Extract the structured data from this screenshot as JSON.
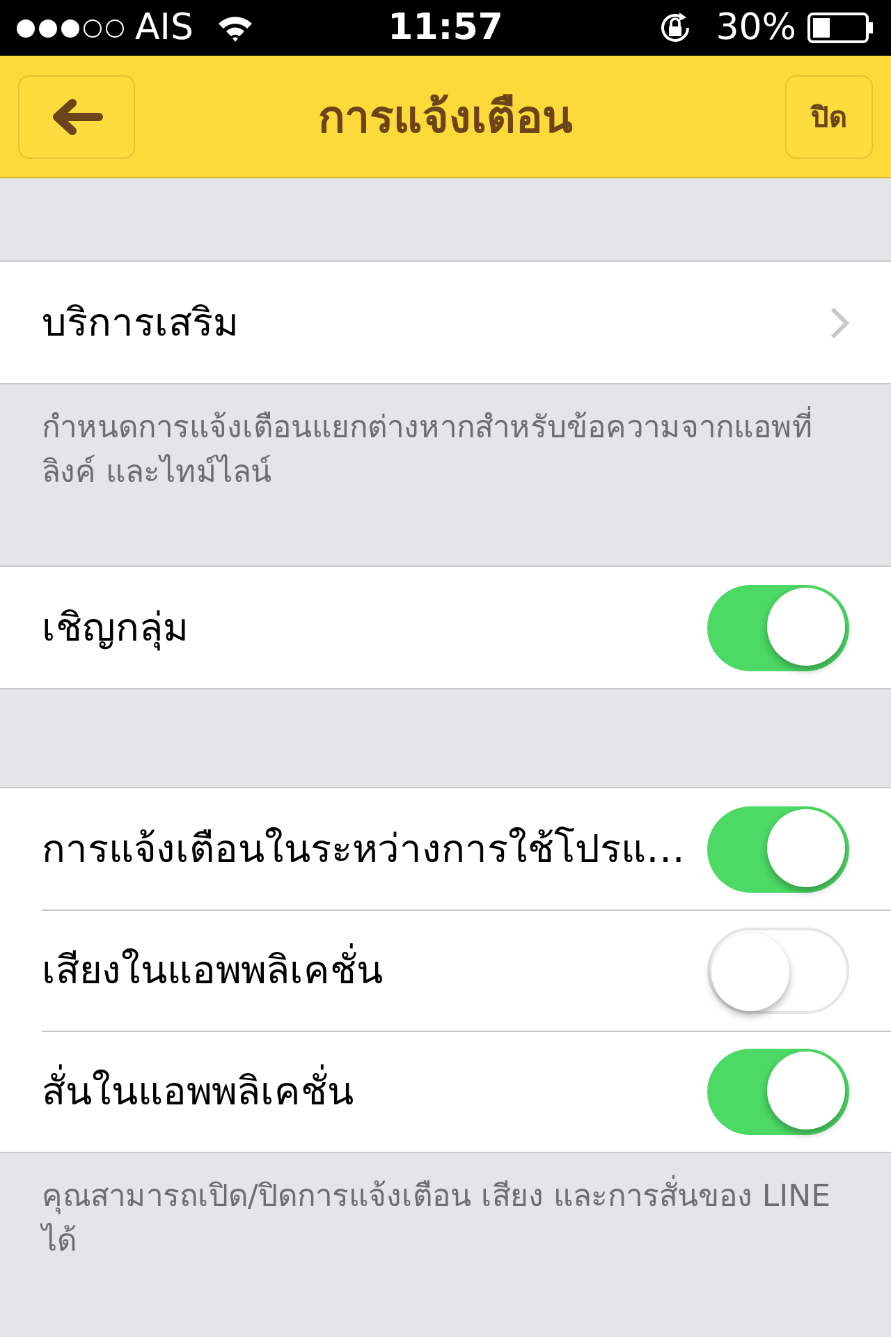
{
  "status_bar": {
    "signal": [
      {
        "filled": true
      },
      {
        "filled": true
      },
      {
        "filled": true
      },
      {
        "filled": false
      },
      {
        "filled": false
      }
    ],
    "carrier": "AIS",
    "time": "11:57",
    "battery": "30%"
  },
  "nav": {
    "title": "การแจ้งเตือน",
    "right_button": "ปิด"
  },
  "sections": [
    {
      "items": [
        {
          "kind": "link",
          "label": "บริการเสริม"
        }
      ],
      "footer": "กำหนดการแจ้งเตือนแยกต่างหากสำหรับข้อความจากแอพที่ลิงค์ และไทม์ไลน์"
    },
    {
      "items": [
        {
          "kind": "toggle",
          "label": "เชิญกลุ่ม",
          "on": true
        }
      ]
    },
    {
      "items": [
        {
          "kind": "toggle",
          "label": "การแจ้งเตือนในระหว่างการใช้โปรแ…",
          "on": true
        },
        {
          "kind": "toggle",
          "label": "เสียงในแอพพลิเคชั่น",
          "on": false
        },
        {
          "kind": "toggle",
          "label": "สั่นในแอพพลิเคชั่น",
          "on": true
        }
      ],
      "footer": "คุณสามารถเปิด/ปิดการแจ้งเตือน เสียง และการสั่นของ LINE ได้"
    }
  ]
}
